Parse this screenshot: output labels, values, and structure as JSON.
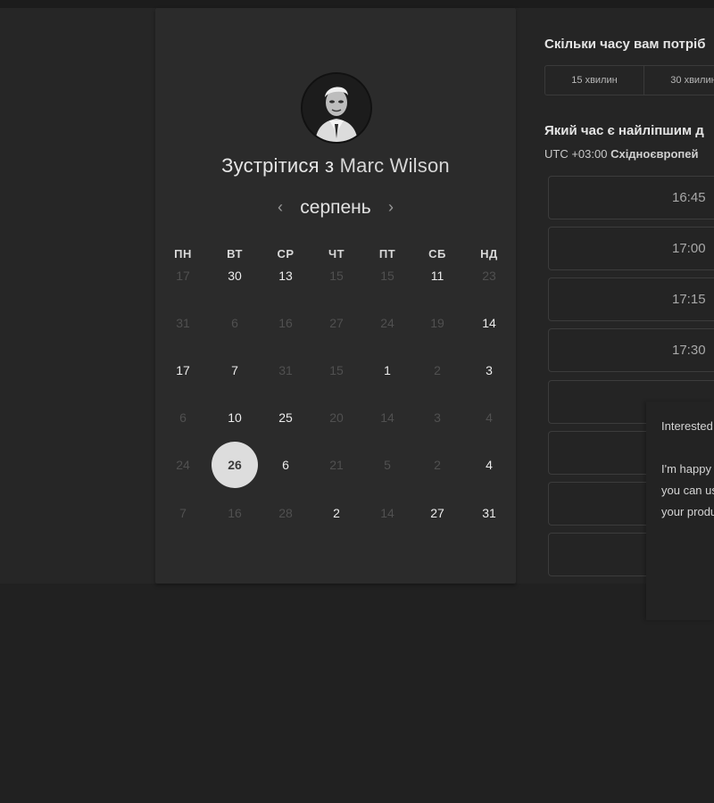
{
  "calendar": {
    "title_prefix": "Зустрітися з",
    "host_name": "Marc Wilson",
    "month": "серпень",
    "prev_icon": "chevron-left-icon",
    "next_icon": "chevron-right-icon",
    "weekdays": [
      "ПН",
      "ВТ",
      "СР",
      "ЧТ",
      "ПТ",
      "СБ",
      "НД"
    ],
    "weeks": [
      [
        {
          "d": "17",
          "m": true
        },
        {
          "d": "30",
          "m": false
        },
        {
          "d": "13",
          "m": false
        },
        {
          "d": "15",
          "m": true
        },
        {
          "d": "15",
          "m": true
        },
        {
          "d": "11",
          "m": false
        },
        {
          "d": "23",
          "m": true
        }
      ],
      [
        {
          "d": "31",
          "m": true
        },
        {
          "d": "6",
          "m": true
        },
        {
          "d": "16",
          "m": true
        },
        {
          "d": "27",
          "m": true
        },
        {
          "d": "24",
          "m": true
        },
        {
          "d": "19",
          "m": true
        },
        {
          "d": "14",
          "m": false
        }
      ],
      [
        {
          "d": "17",
          "m": false
        },
        {
          "d": "7",
          "m": false
        },
        {
          "d": "31",
          "m": true
        },
        {
          "d": "15",
          "m": true
        },
        {
          "d": "1",
          "m": false
        },
        {
          "d": "2",
          "m": true
        },
        {
          "d": "3",
          "m": false
        }
      ],
      [
        {
          "d": "6",
          "m": true
        },
        {
          "d": "10",
          "m": false
        },
        {
          "d": "25",
          "m": false
        },
        {
          "d": "20",
          "m": true
        },
        {
          "d": "14",
          "m": true
        },
        {
          "d": "3",
          "m": true
        },
        {
          "d": "4",
          "m": true
        }
      ],
      [
        {
          "d": "24",
          "m": true
        },
        {
          "d": "26",
          "m": false,
          "selected": true
        },
        {
          "d": "6",
          "m": false
        },
        {
          "d": "21",
          "m": true
        },
        {
          "d": "5",
          "m": true
        },
        {
          "d": "2",
          "m": true
        },
        {
          "d": "4",
          "m": false
        }
      ],
      [
        {
          "d": "7",
          "m": true
        },
        {
          "d": "16",
          "m": true
        },
        {
          "d": "28",
          "m": true
        },
        {
          "d": "2",
          "m": false
        },
        {
          "d": "14",
          "m": true
        },
        {
          "d": "27",
          "m": false
        },
        {
          "d": "31",
          "m": false
        }
      ]
    ]
  },
  "booking": {
    "duration_heading": "Скільки часу вам потріб",
    "durations": [
      "15 хвилин",
      "30 хвилин"
    ],
    "time_heading": "Який час є найліпшим д",
    "timezone_offset": "UTC +03:00",
    "timezone_name": "Східноєвропей",
    "slots": [
      "16:45",
      "17:00",
      "17:15",
      "17:30",
      "",
      "",
      "",
      ""
    ]
  },
  "chat": {
    "paragraph_1": "Interested in Management department",
    "paragraph_2": "I'm happy to give you insight into how you can use our product to improve your productivity"
  }
}
